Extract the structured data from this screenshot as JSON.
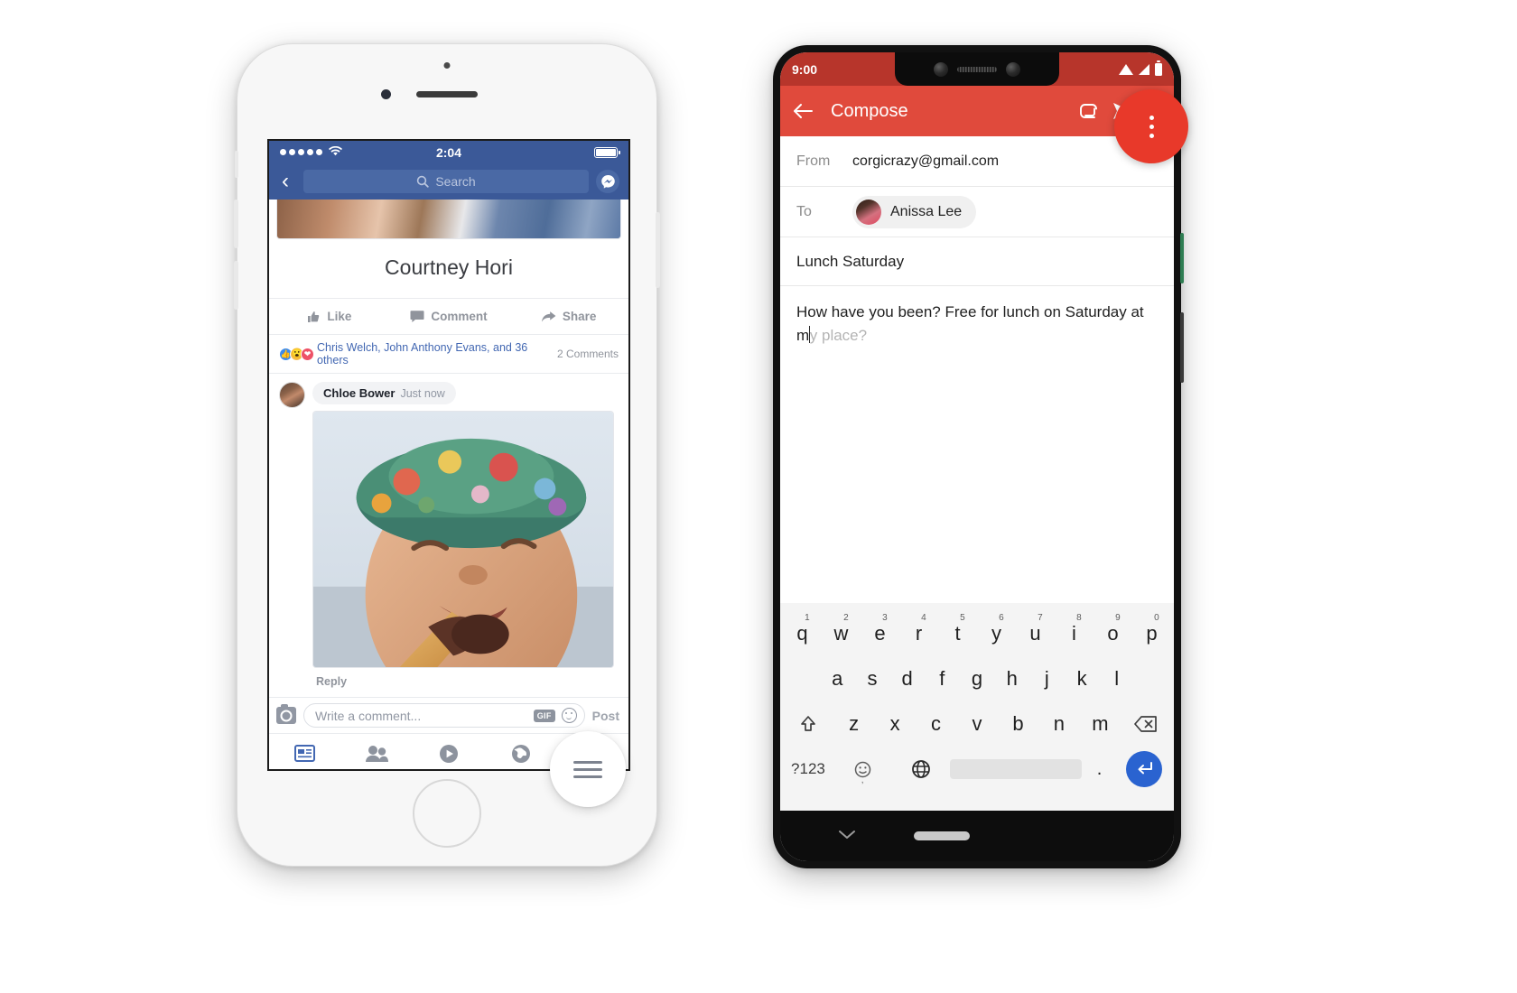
{
  "left_phone": {
    "device": "iphone",
    "app": "Facebook",
    "status_bar": {
      "signal_dots": 5,
      "wifi_icon": "wifi-icon",
      "time": "2:04",
      "battery_icon": "battery-full-icon"
    },
    "nav": {
      "back_icon": "chevron-left-icon",
      "search_placeholder": "Search",
      "search_icon": "search-icon",
      "messenger_icon": "messenger-icon"
    },
    "post": {
      "author_name": "Courtney Hori",
      "actions": [
        {
          "label": "Like",
          "icon": "thumbs-up-icon"
        },
        {
          "label": "Comment",
          "icon": "comment-bubble-icon"
        },
        {
          "label": "Share",
          "icon": "share-arrow-icon"
        }
      ],
      "reactions": {
        "icons": [
          "like-reaction-icon",
          "wow-reaction-icon",
          "love-reaction-icon"
        ],
        "names": "Chris Welch, John Anthony Evans, and 36 others",
        "comment_count": "2 Comments"
      }
    },
    "comment": {
      "author": "Chloe Bower",
      "timestamp": "Just now",
      "attachment_type": "gif-image",
      "reply_label": "Reply"
    },
    "composer": {
      "camera_icon": "camera-icon",
      "placeholder": "Write a comment...",
      "gif_label": "GIF",
      "emoji_icon": "smiley-icon",
      "post_label": "Post"
    },
    "tabbar": [
      {
        "name": "news-feed",
        "icon": "news-feed-icon",
        "active": true
      },
      {
        "name": "friends",
        "icon": "friends-icon",
        "active": false
      },
      {
        "name": "video",
        "icon": "video-play-icon",
        "active": false
      },
      {
        "name": "globe",
        "icon": "globe-notifications-icon",
        "active": false
      }
    ],
    "fab": {
      "icon": "hamburger-menu-icon"
    }
  },
  "right_phone": {
    "device": "pixel",
    "app": "Gmail",
    "status_bar": {
      "time": "9:00",
      "wifi_icon": "wifi-icon",
      "signal_icon": "signal-icon",
      "battery_icon": "battery-icon"
    },
    "appbar": {
      "back_icon": "arrow-back-icon",
      "title": "Compose",
      "attach_icon": "attachment-paperclip-icon",
      "send_icon": "send-icon",
      "overflow_icon": "more-vertical-icon"
    },
    "fields": {
      "from_label": "From",
      "from_value": "corgicrazy@gmail.com",
      "to_label": "To",
      "to_recipient": "Anissa Lee",
      "subject_value": "Lunch Saturday",
      "body_typed": "How have you been? Free for lunch on Saturday at m",
      "body_predicted": "y place?"
    },
    "keyboard": {
      "row1": [
        {
          "key": "q",
          "num": "1"
        },
        {
          "key": "w",
          "num": "2"
        },
        {
          "key": "e",
          "num": "3"
        },
        {
          "key": "r",
          "num": "4"
        },
        {
          "key": "t",
          "num": "5"
        },
        {
          "key": "y",
          "num": "6"
        },
        {
          "key": "u",
          "num": "7"
        },
        {
          "key": "i",
          "num": "8"
        },
        {
          "key": "o",
          "num": "9"
        },
        {
          "key": "p",
          "num": "0"
        }
      ],
      "row2": [
        "a",
        "s",
        "d",
        "f",
        "g",
        "h",
        "j",
        "k",
        "l"
      ],
      "row3": [
        "z",
        "x",
        "c",
        "v",
        "b",
        "n",
        "m"
      ],
      "shift_icon": "shift-arrow-icon",
      "backspace_icon": "backspace-icon",
      "symbols_label": "?123",
      "emoji_icon": "emoji-icon",
      "comma_label": ",",
      "globe_icon": "language-globe-icon",
      "period_label": ".",
      "enter_icon": "enter-return-icon"
    },
    "navbar": {
      "back_chevron_icon": "chevron-down-icon",
      "home_pill_icon": "home-pill-icon"
    },
    "touch_indicator": {
      "icon": "more-vertical-icon",
      "color": "#e8392a"
    }
  },
  "colors": {
    "facebook_blue": "#3b5998",
    "facebook_link": "#4267b2",
    "gmail_red": "#e04a3c",
    "gmail_red_dark": "#b7352b",
    "enter_blue": "#2a63d0"
  }
}
